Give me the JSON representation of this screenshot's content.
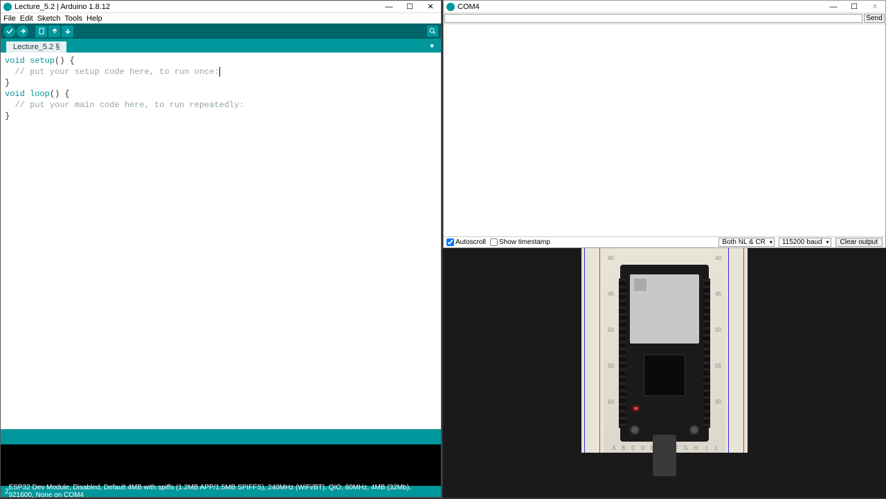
{
  "arduino": {
    "title": "Lecture_5.2 | Arduino 1.8.12",
    "menu": {
      "file": "File",
      "edit": "Edit",
      "sketch": "Sketch",
      "tools": "Tools",
      "help": "Help"
    },
    "tab": {
      "name": "Lecture_5.2 §"
    },
    "code": {
      "l1a": "void",
      "l1b": " setup",
      "l1c": "() {",
      "l2": "  // put your setup code here, to run once:",
      "l3": "",
      "l4": "}",
      "l5": "",
      "l6a": "void",
      "l6b": " loop",
      "l6c": "() {",
      "l7": "  // put your main code here, to run repeatedly:",
      "l8": "",
      "l9": "}"
    },
    "status_left": "2",
    "status_right": "ESP32 Dev Module, Disabled, Default 4MB with spiffs (1.2MB APP/1.5MB SPIFFS), 240MHz (WiFi/BT), QIO, 80MHz, 4MB (32Mb), 921600, None on COM4"
  },
  "serial": {
    "title": "COM4",
    "send": "Send",
    "autoscroll": "Autoscroll",
    "timestamp": "Show timestamp",
    "line_ending": "Both NL & CR",
    "baud": "115200 baud",
    "clear": "Clear output",
    "input_value": ""
  },
  "winctl": {
    "min": "—",
    "max": "☐",
    "close": "✕"
  }
}
